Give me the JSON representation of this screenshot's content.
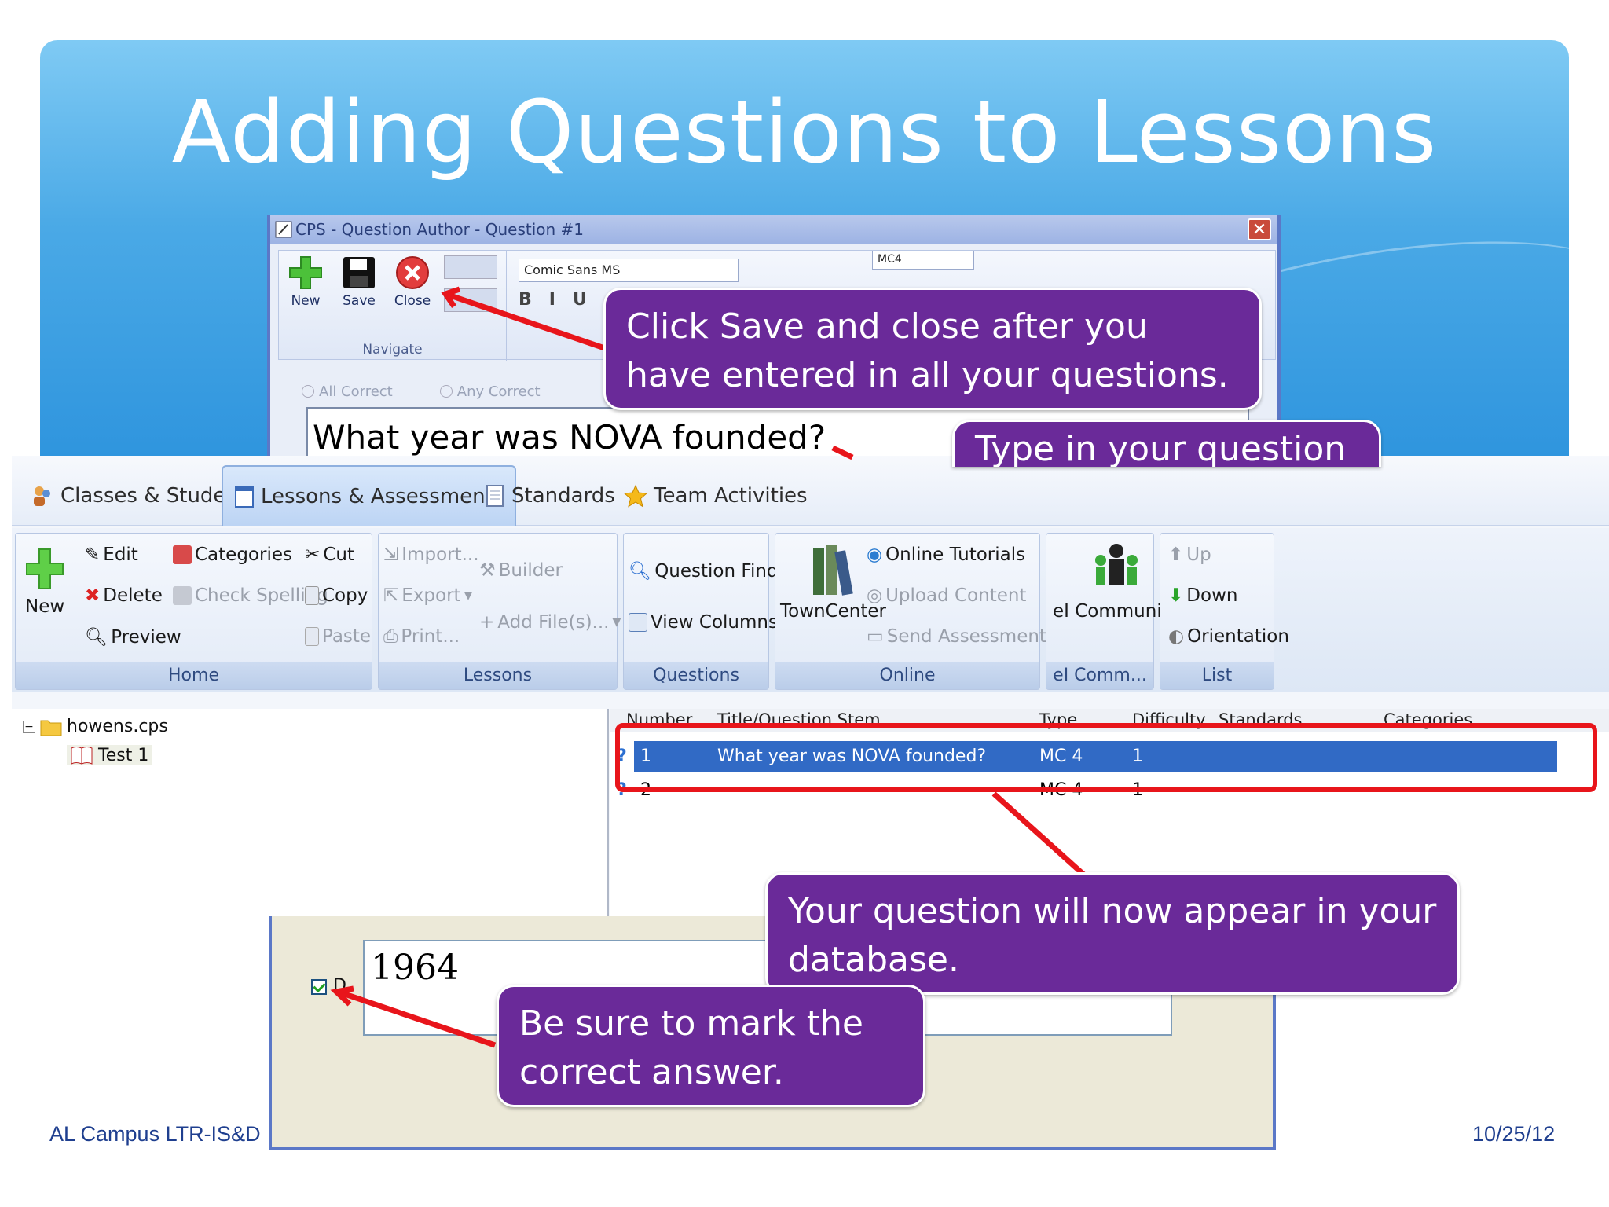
{
  "slide": {
    "title": "Adding Questions to Lessons",
    "footer_left": "AL Campus LTR-IS&D",
    "footer_right": "10/25/12"
  },
  "question_author": {
    "window_title": "CPS - Question Author - Question #1",
    "buttons": {
      "new": "New",
      "save": "Save",
      "close": "Close"
    },
    "group_label": "Navigate",
    "font_name": "Comic Sans MS",
    "format_letters": [
      "B",
      "I",
      "U"
    ],
    "question_type": "MC4",
    "radio_all_correct": "All Correct",
    "radio_any_correct": "Any Correct",
    "question_text": "What year was NOVA founded?"
  },
  "tabs": [
    {
      "label": "Classes & Students",
      "icon": "people-icon"
    },
    {
      "label": "Lessons & Assessments",
      "icon": "document-icon",
      "active": true
    },
    {
      "label": "Standards",
      "icon": "page-icon"
    },
    {
      "label": "Team Activities",
      "icon": "star-icon"
    }
  ],
  "ribbon": {
    "home": {
      "label": "Home",
      "new": "New",
      "edit": "Edit",
      "delete": "Delete",
      "preview": "Preview",
      "categories": "Categories",
      "check_spelling": "Check Spelling",
      "cut": "Cut",
      "copy": "Copy",
      "paste": "Paste"
    },
    "lessons": {
      "label": "Lessons",
      "import": "Import...",
      "export": "Export",
      "print": "Print...",
      "builder": "Builder",
      "add_files": "Add File(s)..."
    },
    "questions": {
      "label": "Questions",
      "finder": "Question Finder",
      "view_columns": "View Columns"
    },
    "online": {
      "label": "Online",
      "towncenter": "TownCenter",
      "tutorials": "Online Tutorials",
      "upload": "Upload Content",
      "send": "Send Assessment..."
    },
    "community": {
      "label": "eI Comm...",
      "item": "eI Community"
    },
    "list": {
      "label": "List",
      "up": "Up",
      "down": "Down",
      "orientation": "Orientation"
    }
  },
  "tree": {
    "root": "howens.cps",
    "child": "Test 1"
  },
  "grid": {
    "columns": [
      "Number",
      "Title/Question Stem",
      "Type",
      "Difficulty",
      "Standards",
      "Categories"
    ],
    "rows": [
      {
        "number": "1",
        "stem": "What year was NOVA founded?",
        "type": "MC 4",
        "difficulty": "1"
      },
      {
        "number": "2",
        "stem": "",
        "type": "MC 4",
        "difficulty": "1"
      }
    ]
  },
  "answer": {
    "letter": "D",
    "text": "1964"
  },
  "callouts": {
    "save_close": "Click Save and close after you have entered in all your questions.",
    "type_question": "Type in your question",
    "appear_database": "Your question will now appear in your database.",
    "mark_correct": "Be sure to mark the correct answer."
  },
  "colors": {
    "callout": "#6a2a99",
    "arrow": "#e8151b",
    "header": "#4aa9e6",
    "selected_row": "#316ac5"
  }
}
